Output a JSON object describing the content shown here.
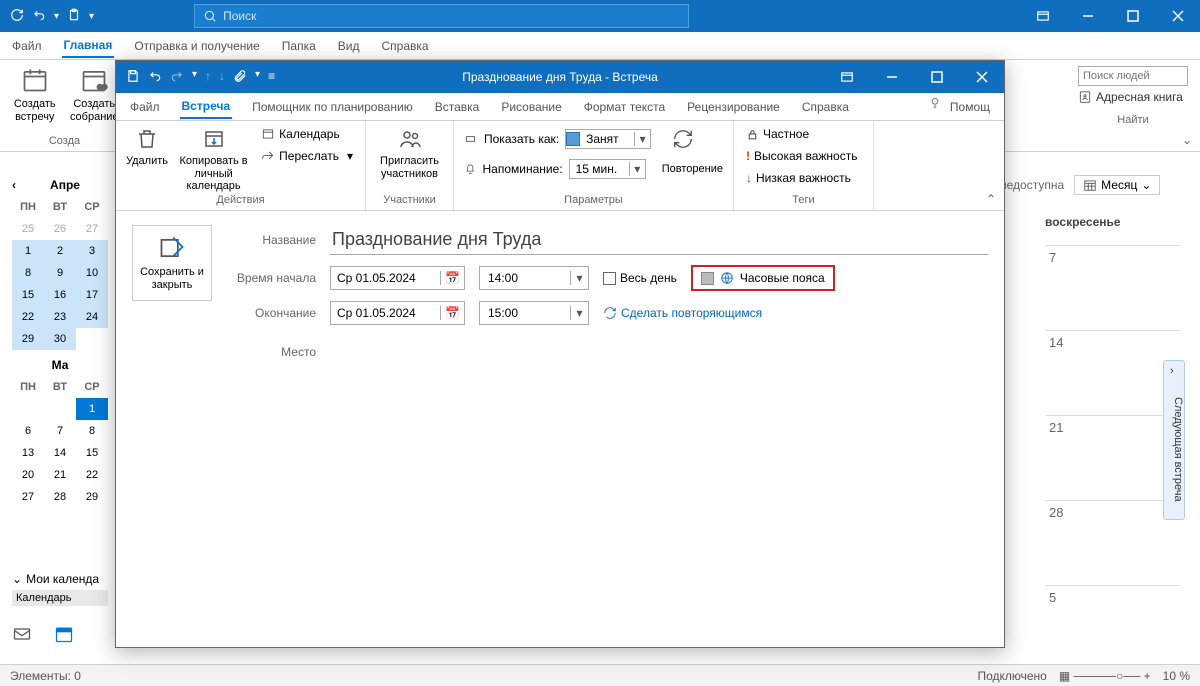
{
  "titlebar": {
    "search_placeholder": "Поиск"
  },
  "menu": {
    "file": "Файл",
    "home": "Главная",
    "sendrecv": "Отправка и получение",
    "folder": "Папка",
    "view": "Вид",
    "help": "Справка"
  },
  "ribbon_main": {
    "new_meeting": "Создать\nвстречу",
    "new_gathering": "Создать\nсобрание",
    "group1_title": "Созда",
    "search_people_ph": "Поиск людей",
    "address_book": "Адресная книга",
    "group_find": "Найти"
  },
  "nav": {
    "month1": "Апре",
    "month2": "Ма",
    "dow1": "ПН",
    "dow2": "ВТ",
    "dow3": "СР",
    "cal_header": "Мои календа",
    "cal_item": "Календарь"
  },
  "status": {
    "elements": "Элементы: 0",
    "connected": "Подключено",
    "zoom": "10 %"
  },
  "cal": {
    "unavail": "недоступна",
    "month_btn": "Месяц",
    "wk_sun": "воскресенье",
    "d7": "7",
    "d14": "14",
    "d21": "21",
    "d28": "28",
    "d5": "5",
    "side": "Следующая встреча"
  },
  "modal": {
    "title": "Празднование дня Труда  -  Встреча",
    "mfile": "Файл",
    "mmeeting": "Встреча",
    "mplan": "Помощник по планированию",
    "minsert": "Вставка",
    "mdraw": "Рисование",
    "mformat": "Формат текста",
    "mreview": "Рецензирование",
    "mhelp": "Справка",
    "mtell": "Помощ",
    "delete": "Удалить",
    "copy": "Копировать в личный календарь",
    "calendar": "Календарь",
    "forward": "Переслать",
    "actions": "Действия",
    "invite": "Пригласить участников",
    "participants": "Участники",
    "show_as": "Показать как:",
    "busy": "Занят",
    "remind": "Напоминание:",
    "remind_v": "15 мин.",
    "recur": "Повторение",
    "params": "Параметры",
    "private": "Частное",
    "high": "Высокая важность",
    "low": "Низкая важность",
    "tags": "Теги",
    "save_close": "Сохранить и закрыть",
    "lbl_name": "Название",
    "lbl_start": "Время начала",
    "lbl_end": "Окончание",
    "lbl_loc": "Место",
    "subject": "Празднование дня Труда",
    "date": "Ср 01.05.2024",
    "t_start": "14:00",
    "t_end": "15:00",
    "allday": "Весь день",
    "tz": "Часовые пояса",
    "make_recur": "Сделать повторяющимся"
  }
}
